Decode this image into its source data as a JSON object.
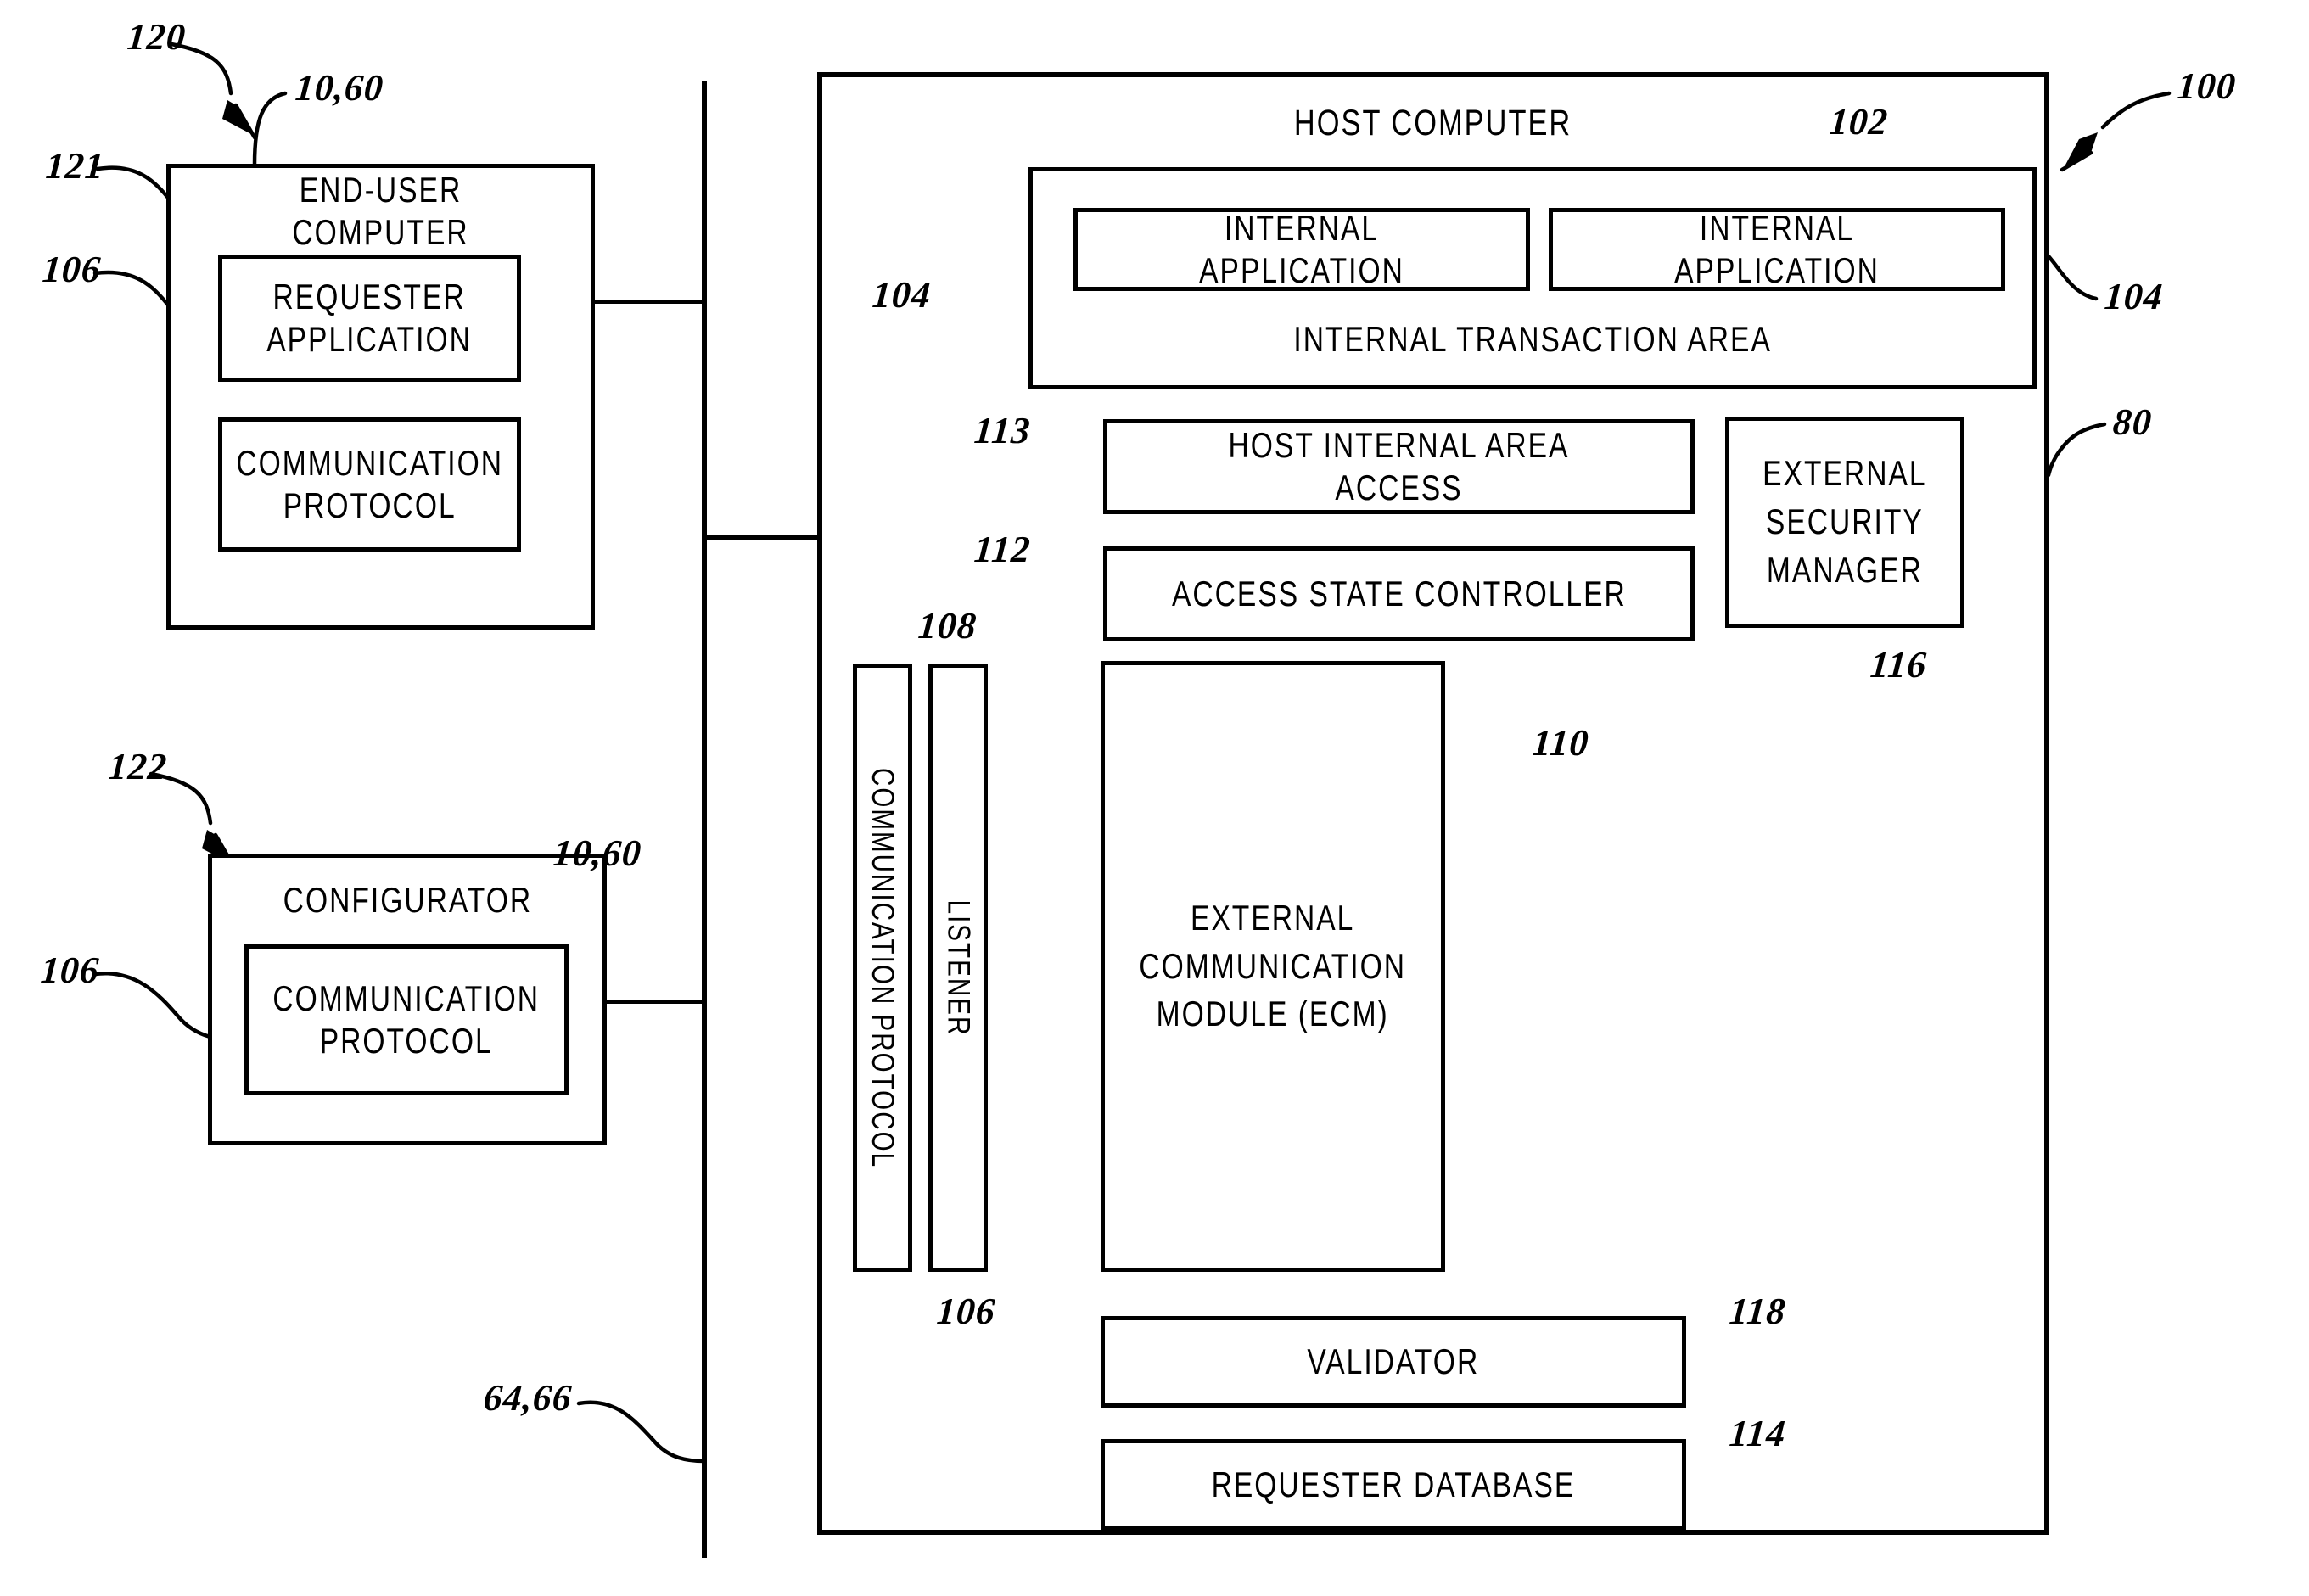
{
  "figure": {
    "type": "patent-block-diagram",
    "boxes": {
      "end_user_computer": "END-USER COMPUTER",
      "requester_application": "REQUESTER\nAPPLICATION",
      "end_user_comm_protocol": "COMMUNICATION\nPROTOCOL",
      "configurator": "CONFIGURATOR",
      "configurator_comm_protocol": "COMMUNICATION\nPROTOCOL",
      "host_computer": "HOST COMPUTER",
      "internal_transaction_area": "INTERNAL TRANSACTION AREA",
      "internal_application_left": "INTERNAL APPLICATION",
      "internal_application_right": "INTERNAL APPLICATION",
      "host_internal_area_access": "HOST INTERNAL AREA ACCESS",
      "access_state_controller": "ACCESS STATE CONTROLLER",
      "external_security_manager": "EXTERNAL\nSECURITY\nMANAGER",
      "host_comm_protocol": "COMMUNICATION PROTOCOL",
      "listener": "LISTENER",
      "external_communication_module": "EXTERNAL\nCOMMUNICATION\nMODULE (ECM)",
      "validator": "VALIDATOR",
      "requester_database": "REQUESTER DATABASE"
    },
    "reference_numerals": {
      "n120": "120",
      "n121": "121",
      "n106_enduser": "106",
      "n1060_enduser": "10,60",
      "n122": "122",
      "n106_config": "106",
      "n1060_config": "10,60",
      "n6466": "64,66",
      "n100": "100",
      "n102": "102",
      "n104_left": "104",
      "n104_right": "104",
      "n80": "80",
      "n113": "113",
      "n112": "112",
      "n116": "116",
      "n108": "108",
      "n106_host": "106",
      "n110": "110",
      "n118": "118",
      "n114": "114"
    },
    "colors": {
      "ink": "#000000",
      "paper": "#ffffff"
    }
  }
}
